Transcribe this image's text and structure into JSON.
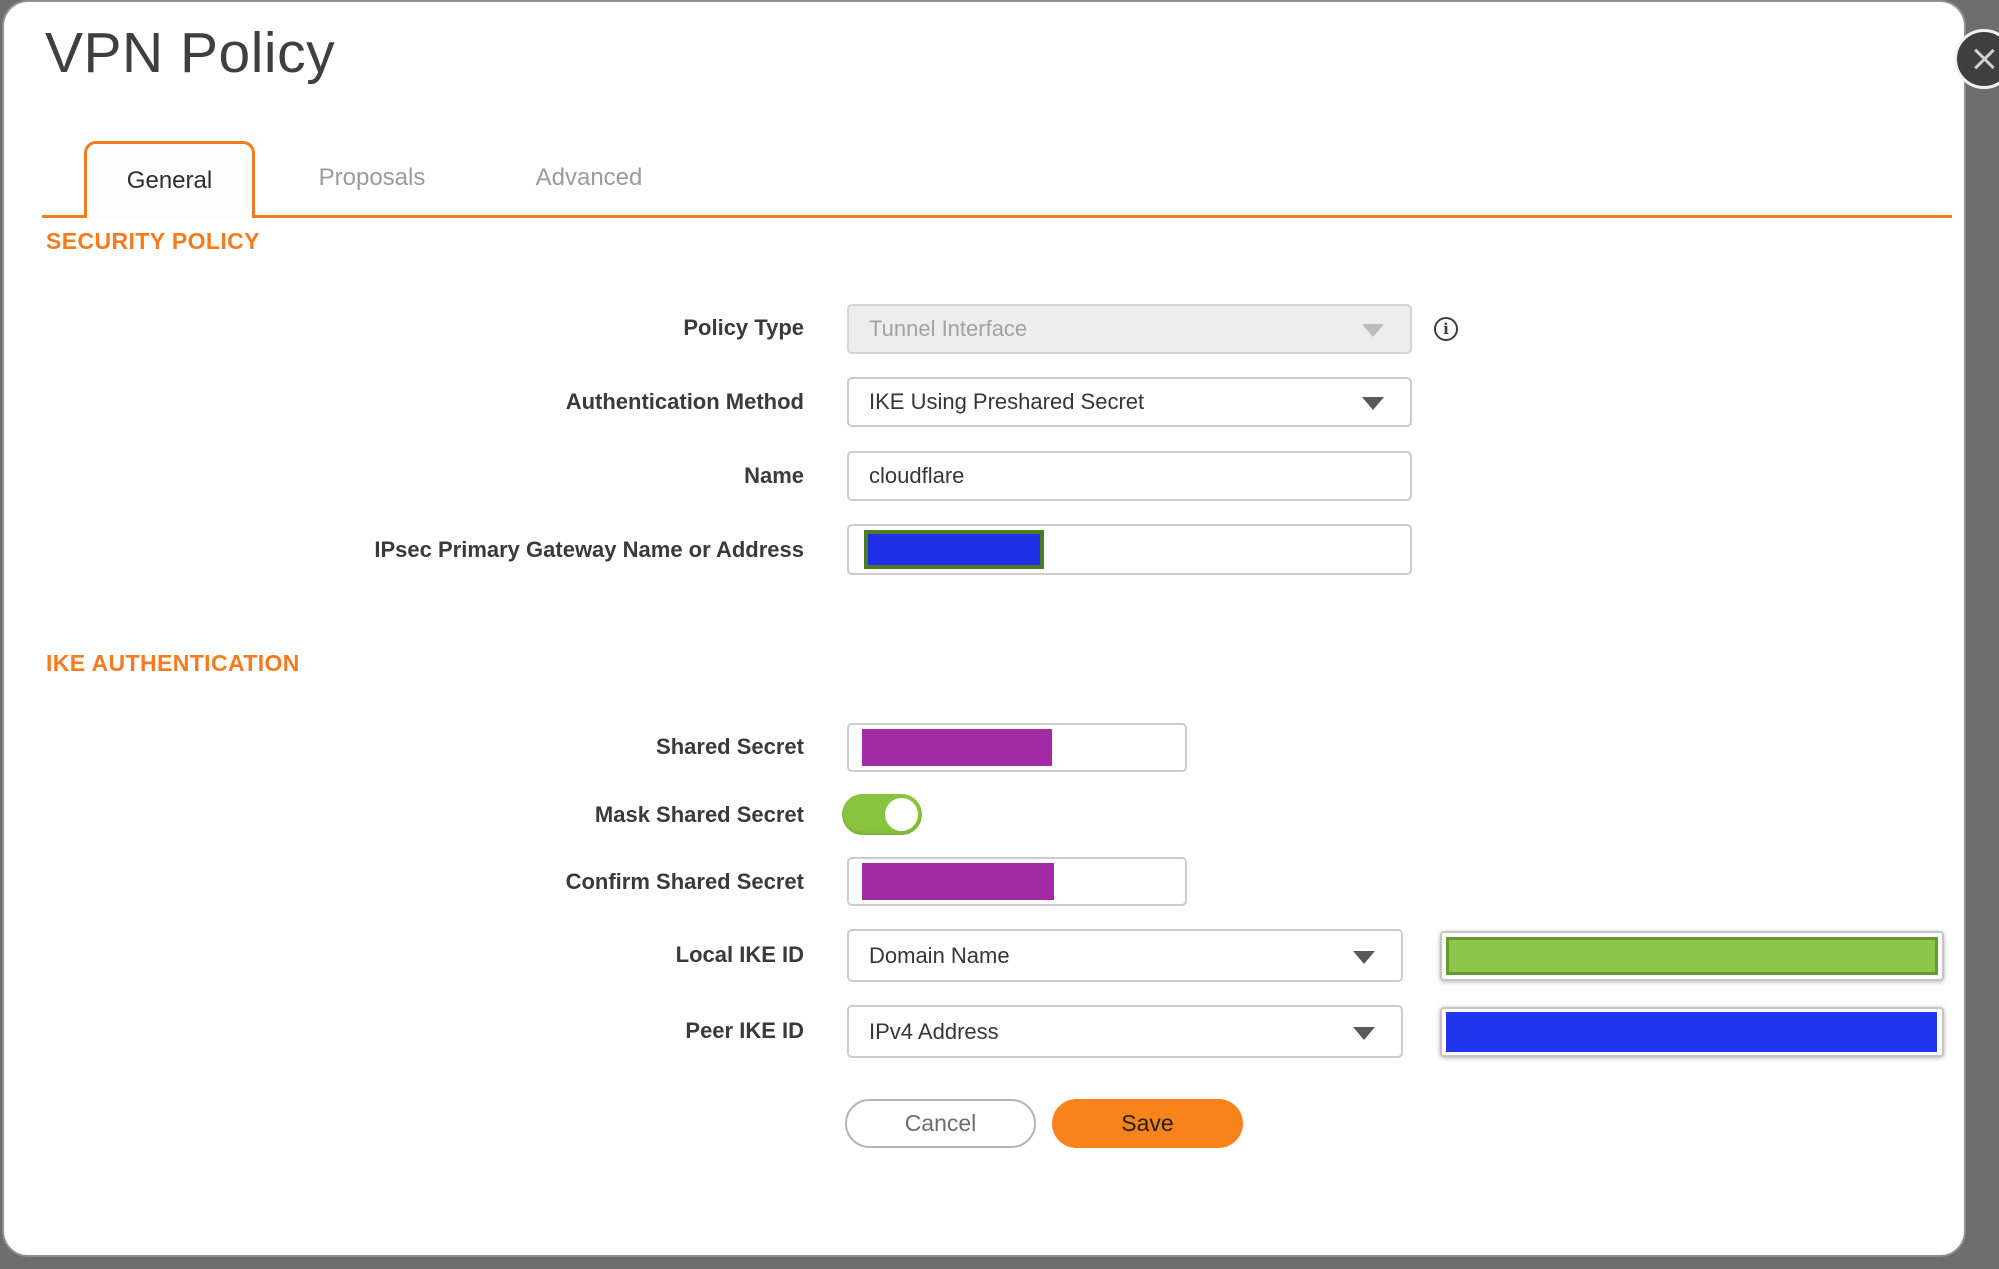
{
  "dialog": {
    "title": "VPN Policy"
  },
  "tabs": [
    {
      "label": "General",
      "active": true
    },
    {
      "label": "Proposals",
      "active": false
    },
    {
      "label": "Advanced",
      "active": false
    }
  ],
  "sections": {
    "security_policy": {
      "heading": "SECURITY POLICY",
      "fields": {
        "policy_type": {
          "label": "Policy Type",
          "value": "Tunnel Interface",
          "disabled": true
        },
        "authentication_method": {
          "label": "Authentication Method",
          "value": "IKE Using Preshared Secret"
        },
        "name": {
          "label": "Name",
          "value": "cloudflare"
        },
        "gateway": {
          "label": "IPsec Primary Gateway Name or Address",
          "value_state": "redacted",
          "redaction_color": "#2030E8",
          "redaction_border": "#4C7B21"
        }
      }
    },
    "ike_authentication": {
      "heading": "IKE AUTHENTICATION",
      "fields": {
        "shared_secret": {
          "label": "Shared Secret",
          "value_state": "redacted",
          "redaction_color": "#A02BA5"
        },
        "mask_shared_secret": {
          "label": "Mask Shared Secret",
          "enabled": true
        },
        "confirm_shared_secret": {
          "label": "Confirm Shared Secret",
          "value_state": "redacted",
          "redaction_color": "#A02BA5"
        },
        "local_ike_id": {
          "label": "Local IKE ID",
          "type_value": "Domain Name",
          "value_state": "redacted",
          "redaction_color": "#8CC64B",
          "redaction_border": "#639A30"
        },
        "peer_ike_id": {
          "label": "Peer IKE ID",
          "type_value": "IPv4 Address",
          "value_state": "redacted",
          "redaction_color": "#1F35EE"
        }
      }
    }
  },
  "buttons": {
    "cancel": "Cancel",
    "save": "Save"
  },
  "icons": {
    "info": "i"
  },
  "colors": {
    "accent_orange": "#F47B20",
    "save_orange": "#F8821C",
    "toggle_green": "#8AC43E",
    "backdrop_gray": "#6D6D6D"
  }
}
